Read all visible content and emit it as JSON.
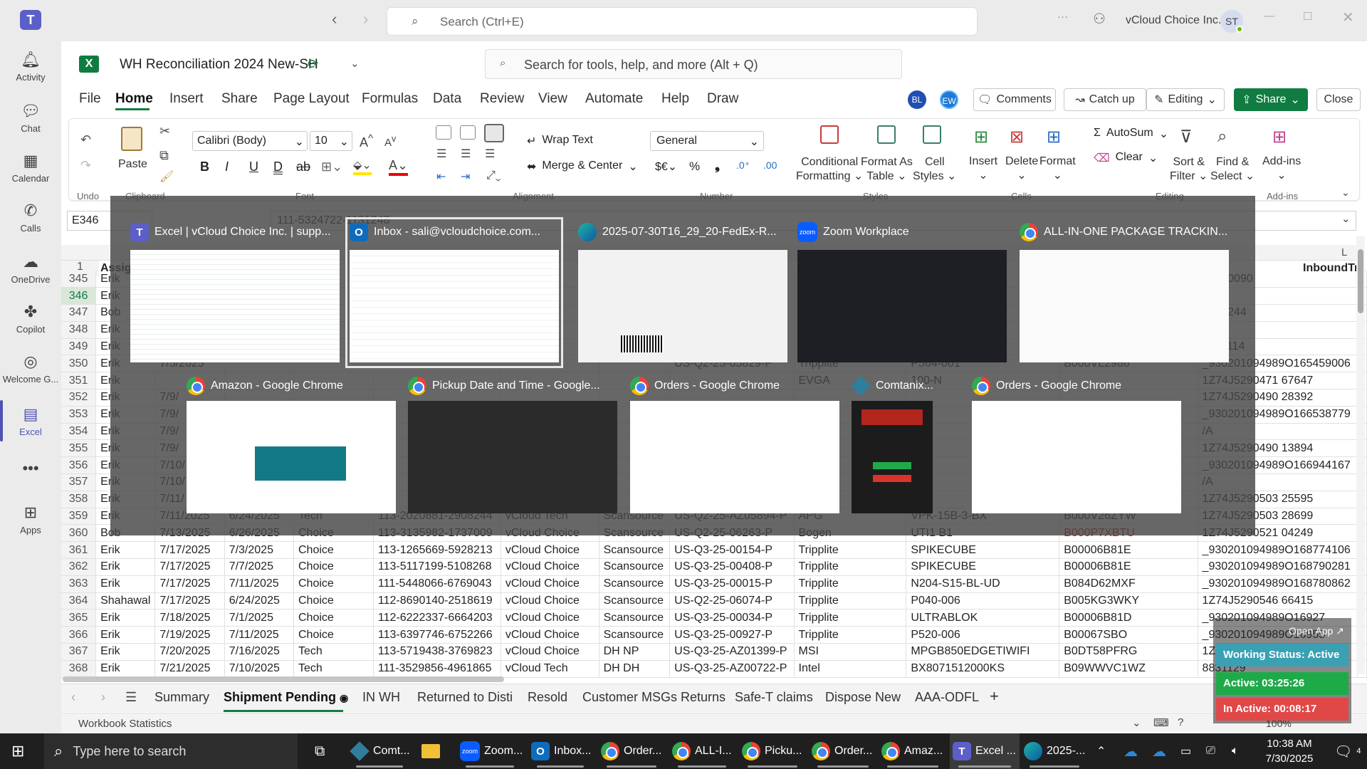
{
  "teams": {
    "search_placeholder": "Search (Ctrl+E)",
    "org": "vCloud Choice Inc.",
    "avatar": "ST",
    "rail": [
      "Activity",
      "Chat",
      "Calendar",
      "Calls",
      "OneDrive",
      "Copilot",
      "Welcome G...",
      "Excel",
      "",
      "Apps"
    ]
  },
  "excel": {
    "title": "WH Reconciliation 2024 New-SH",
    "tools_search": "Search for tools, help, and more (Alt + Q)",
    "tabs": [
      "File",
      "Home",
      "Insert",
      "Share",
      "Page Layout",
      "Formulas",
      "Data",
      "Review",
      "View",
      "Automate",
      "Help",
      "Draw"
    ],
    "presence": [
      "BL",
      "EW"
    ],
    "comments": "Comments",
    "catchup": "Catch up",
    "editing": "Editing",
    "share": "Share",
    "close": "Close",
    "ribbon": {
      "undo": "Undo",
      "paste": "Paste",
      "clipboard": "Clipboard",
      "font_name": "Calibri (Body)",
      "font_size": "10",
      "font": "Font",
      "wrap": "Wrap Text",
      "merge": "Merge & Center",
      "alignment": "Alignment",
      "number_format": "General",
      "number": "Number",
      "cond_fmt": [
        "Conditional",
        "Formatting"
      ],
      "fmt_table": [
        "Format As",
        "Table"
      ],
      "cell_styles": [
        "Cell",
        "Styles"
      ],
      "styles": "Styles",
      "insert": "Insert",
      "delete": "Delete",
      "format": "Format",
      "cells": "Cells",
      "autosum": "AutoSum",
      "clear": "Clear",
      "sort": [
        "Sort &",
        "Filter"
      ],
      "find": [
        "Find &",
        "Select"
      ],
      "editing_grp": "Editing",
      "addins": "Add-ins"
    },
    "name_box": "E346",
    "formula": "111-5324722-1131248",
    "col_L": "L",
    "col_inbound": "InboundTra",
    "header_row1": "Assigne",
    "rows": [
      {
        "n": "345",
        "a": "Erik",
        "b": "",
        "c": "",
        "d": "",
        "e": "",
        "f": "",
        "g": "",
        "h": "",
        "i": "",
        "j": "",
        "k": "",
        "l": "04810090"
      },
      {
        "n": "346",
        "a": "Erik",
        "b": "",
        "c": "",
        "d": "",
        "e": "",
        "f": "",
        "g": "",
        "h": "",
        "i": "",
        "j": "",
        "k": "",
        "l": ""
      },
      {
        "n": "347",
        "a": "Bob",
        "b": "",
        "c": "",
        "d": "",
        "e": "",
        "f": "",
        "g": "",
        "h": "",
        "i": "",
        "j": "",
        "k": "",
        "l": "5360244"
      },
      {
        "n": "348",
        "a": "Erik",
        "b": "",
        "c": "",
        "d": "",
        "e": "",
        "f": "",
        "g": "",
        "h": "",
        "i": "",
        "j": "",
        "k": "",
        "l": "61"
      },
      {
        "n": "349",
        "a": "Erik",
        "b": "",
        "c": "",
        "d": "",
        "e": "",
        "f": "",
        "g": "",
        "h": "",
        "i": "",
        "j": "",
        "k": "",
        "l": "6941114"
      },
      {
        "n": "350",
        "a": "Erik",
        "b": "7/5/2025",
        "c": "",
        "d": "",
        "e": "",
        "f": "",
        "g": "",
        "h": "US-Q2-25-05829-P",
        "i": "Tripplite",
        "j": "P564-001",
        "k": "B000VL2986",
        "l": "_930201094989O165459006"
      },
      {
        "n": "351",
        "a": "Erik",
        "b": "",
        "c": "",
        "d": "",
        "e": "",
        "f": "",
        "g": "",
        "h": "",
        "i": "EVGA",
        "j": "100-N",
        "k": "",
        "l": "1Z74J5290471 67647"
      },
      {
        "n": "352",
        "a": "Erik",
        "b": "7/9/",
        "c": "",
        "d": "",
        "e": "",
        "f": "",
        "g": "",
        "h": "",
        "i": "",
        "j": "",
        "k": "",
        "l": "1Z74J5290490 28392"
      },
      {
        "n": "353",
        "a": "Erik",
        "b": "7/9/",
        "c": "",
        "d": "",
        "e": "",
        "f": "",
        "g": "",
        "h": "",
        "i": "",
        "j": "",
        "k": "",
        "l": "_930201094989O166538779"
      },
      {
        "n": "354",
        "a": "Erik",
        "b": "7/9/",
        "c": "",
        "d": "",
        "e": "",
        "f": "",
        "g": "",
        "h": "",
        "i": "",
        "j": "",
        "k": "",
        "l": "/A"
      },
      {
        "n": "355",
        "a": "Erik",
        "b": "7/9/",
        "c": "",
        "d": "",
        "e": "",
        "f": "",
        "g": "",
        "h": "",
        "i": "",
        "j": "",
        "k": "",
        "l": "1Z74J5290490 13894"
      },
      {
        "n": "356",
        "a": "Erik",
        "b": "7/10/",
        "c": "",
        "d": "",
        "e": "",
        "f": "",
        "g": "",
        "h": "",
        "i": "",
        "j": "",
        "k": "",
        "l": "_930201094989O166944167"
      },
      {
        "n": "357",
        "a": "Erik",
        "b": "7/10/",
        "c": "",
        "d": "",
        "e": "",
        "f": "",
        "g": "",
        "h": "",
        "i": "",
        "j": "",
        "k": "",
        "l": "/A"
      },
      {
        "n": "358",
        "a": "Erik",
        "b": "7/11/",
        "c": "",
        "d": "",
        "e": "",
        "f": "",
        "g": "",
        "h": "",
        "i": "",
        "j": "",
        "k": "",
        "l": "1Z74J5290503 25595"
      },
      {
        "n": "359",
        "a": "Erik",
        "b": "7/11/2025",
        "c": "6/24/2025",
        "d": "Tech",
        "e": "113-2020881-2908244",
        "f": "vCloud Tech",
        "g": "Scansource",
        "h": "US-Q2-25-AZ05894-P",
        "i": "APG",
        "j": "VPK-15B-3-BX",
        "k": "B000V26ZYW",
        "l": "1Z74J5290503 28699"
      },
      {
        "n": "360",
        "a": "Bob",
        "b": "7/13/2025",
        "c": "6/26/2025",
        "d": "Choice",
        "e": "113-3135982-1737009",
        "f": "vCloud Choice",
        "g": "Scansource",
        "h": "US-Q2-25-06263-P",
        "i": "Bogen",
        "j": "UTI1 B1",
        "k": "B000P7XBTU",
        "l": "1Z74J5290521 04249"
      },
      {
        "n": "361",
        "a": "Erik",
        "b": "7/17/2025",
        "c": "7/3/2025",
        "d": "Choice",
        "e": "113-1265669-5928213",
        "f": "vCloud Choice",
        "g": "Scansource",
        "h": "US-Q3-25-00154-P",
        "i": "Tripplite",
        "j": "SPIKECUBE",
        "k": "B00006B81E",
        "l": "_930201094989O168774106"
      },
      {
        "n": "362",
        "a": "Erik",
        "b": "7/17/2025",
        "c": "7/7/2025",
        "d": "Choice",
        "e": "113-5117199-5108268",
        "f": "vCloud Choice",
        "g": "Scansource",
        "h": "US-Q3-25-00408-P",
        "i": "Tripplite",
        "j": "SPIKECUBE",
        "k": "B00006B81E",
        "l": "_930201094989O168790281"
      },
      {
        "n": "363",
        "a": "Erik",
        "b": "7/17/2025",
        "c": "7/11/2025",
        "d": "Choice",
        "e": "111-5448066-6769043",
        "f": "vCloud Choice",
        "g": "Scansource",
        "h": "US-Q3-25-00015-P",
        "i": "Tripplite",
        "j": "N204-S15-BL-UD",
        "k": "B084D62MXF",
        "l": "_930201094989O168780862"
      },
      {
        "n": "364",
        "a": "Shahawal",
        "b": "7/17/2025",
        "c": "6/24/2025",
        "d": "Choice",
        "e": "112-8690140-2518619",
        "f": "vCloud Choice",
        "g": "Scansource",
        "h": "US-Q2-25-06074-P",
        "i": "Tripplite",
        "j": "P040-006",
        "k": "B005KG3WKY",
        "l": "1Z74J5290546 66415"
      },
      {
        "n": "365",
        "a": "Erik",
        "b": "7/18/2025",
        "c": "7/1/2025",
        "d": "Choice",
        "e": "112-6222337-6664203",
        "f": "vCloud Choice",
        "g": "Scansource",
        "h": "US-Q3-25-00034-P",
        "i": "Tripplite",
        "j": "ULTRABLOK",
        "k": "B00006B81D",
        "l": "_930201094989O16927"
      },
      {
        "n": "366",
        "a": "Erik",
        "b": "7/19/2025",
        "c": "7/11/2025",
        "d": "Choice",
        "e": "113-6397746-6752266",
        "f": "vCloud Choice",
        "g": "Scansource",
        "h": "US-Q3-25-00927-P",
        "i": "Tripplite",
        "j": "P520-006",
        "k": "B00067SBO",
        "l": "_930201094989O16955"
      },
      {
        "n": "367",
        "a": "Erik",
        "b": "7/20/2025",
        "c": "7/16/2025",
        "d": "Tech",
        "e": "113-5719438-3769823",
        "f": "vCloud Choice",
        "g": "DH NP",
        "h": "US-Q3-25-AZ01399-P",
        "i": "MSI",
        "j": "MPGB850EDGETIWIFI",
        "k": "B0DT58PFRG",
        "l": "1Z74J5"
      },
      {
        "n": "368",
        "a": "Erik",
        "b": "7/21/2025",
        "c": "7/10/2025",
        "d": "Tech",
        "e": "111-3529856-4961865",
        "f": "vCloud Tech",
        "g": "DH DH",
        "h": "US-Q3-25-AZ00722-P",
        "i": "Intel",
        "j": "BX8071512000KS",
        "k": "B09WWVC1WZ",
        "l": "8831129"
      }
    ],
    "sheet_tabs": [
      "Summary",
      "Shipment Pending",
      "IN WH",
      "Returned to Disti",
      "Resold",
      "Customer MSGs Returns",
      "Safe-T claims",
      "Dispose New",
      "AAA-ODFL"
    ],
    "status_left": "Workbook Statistics",
    "zoom": "100%"
  },
  "switcher": [
    {
      "title": "Excel | vCloud Choice Inc. | supp...",
      "icon": "teams"
    },
    {
      "title": "Inbox - sali@vcloudchoice.com...",
      "icon": "outlook"
    },
    {
      "title": "2025-07-30T16_29_20-FedEx-R...",
      "icon": "edge"
    },
    {
      "title": "Zoom Workplace",
      "icon": "zoom"
    },
    {
      "title": "ALL-IN-ONE PACKAGE TRACKIN...",
      "icon": "chrome"
    },
    {
      "title": "Amazon - Google Chrome",
      "icon": "chrome"
    },
    {
      "title": "Pickup Date and Time - Google...",
      "icon": "chrome"
    },
    {
      "title": "Orders - Google Chrome",
      "icon": "chrome"
    },
    {
      "title": "Comtanix...",
      "icon": "comt"
    },
    {
      "title": "Orders - Google Chrome",
      "icon": "chrome"
    }
  ],
  "widget": {
    "open_app": "Open App",
    "working": "Working Status: Active",
    "active": "Active: 03:25:26",
    "inactive": "In Active: 00:08:17"
  },
  "taskbar": {
    "search": "Type here to search",
    "items": [
      "Comt...",
      "",
      "Zoom...",
      "Inbox...",
      "Order...",
      "ALL-I...",
      "Picku...",
      "Order...",
      "Amaz...",
      "Excel ...",
      "2025-..."
    ],
    "time": "10:38 AM",
    "date": "7/30/2025",
    "notif": "4"
  }
}
